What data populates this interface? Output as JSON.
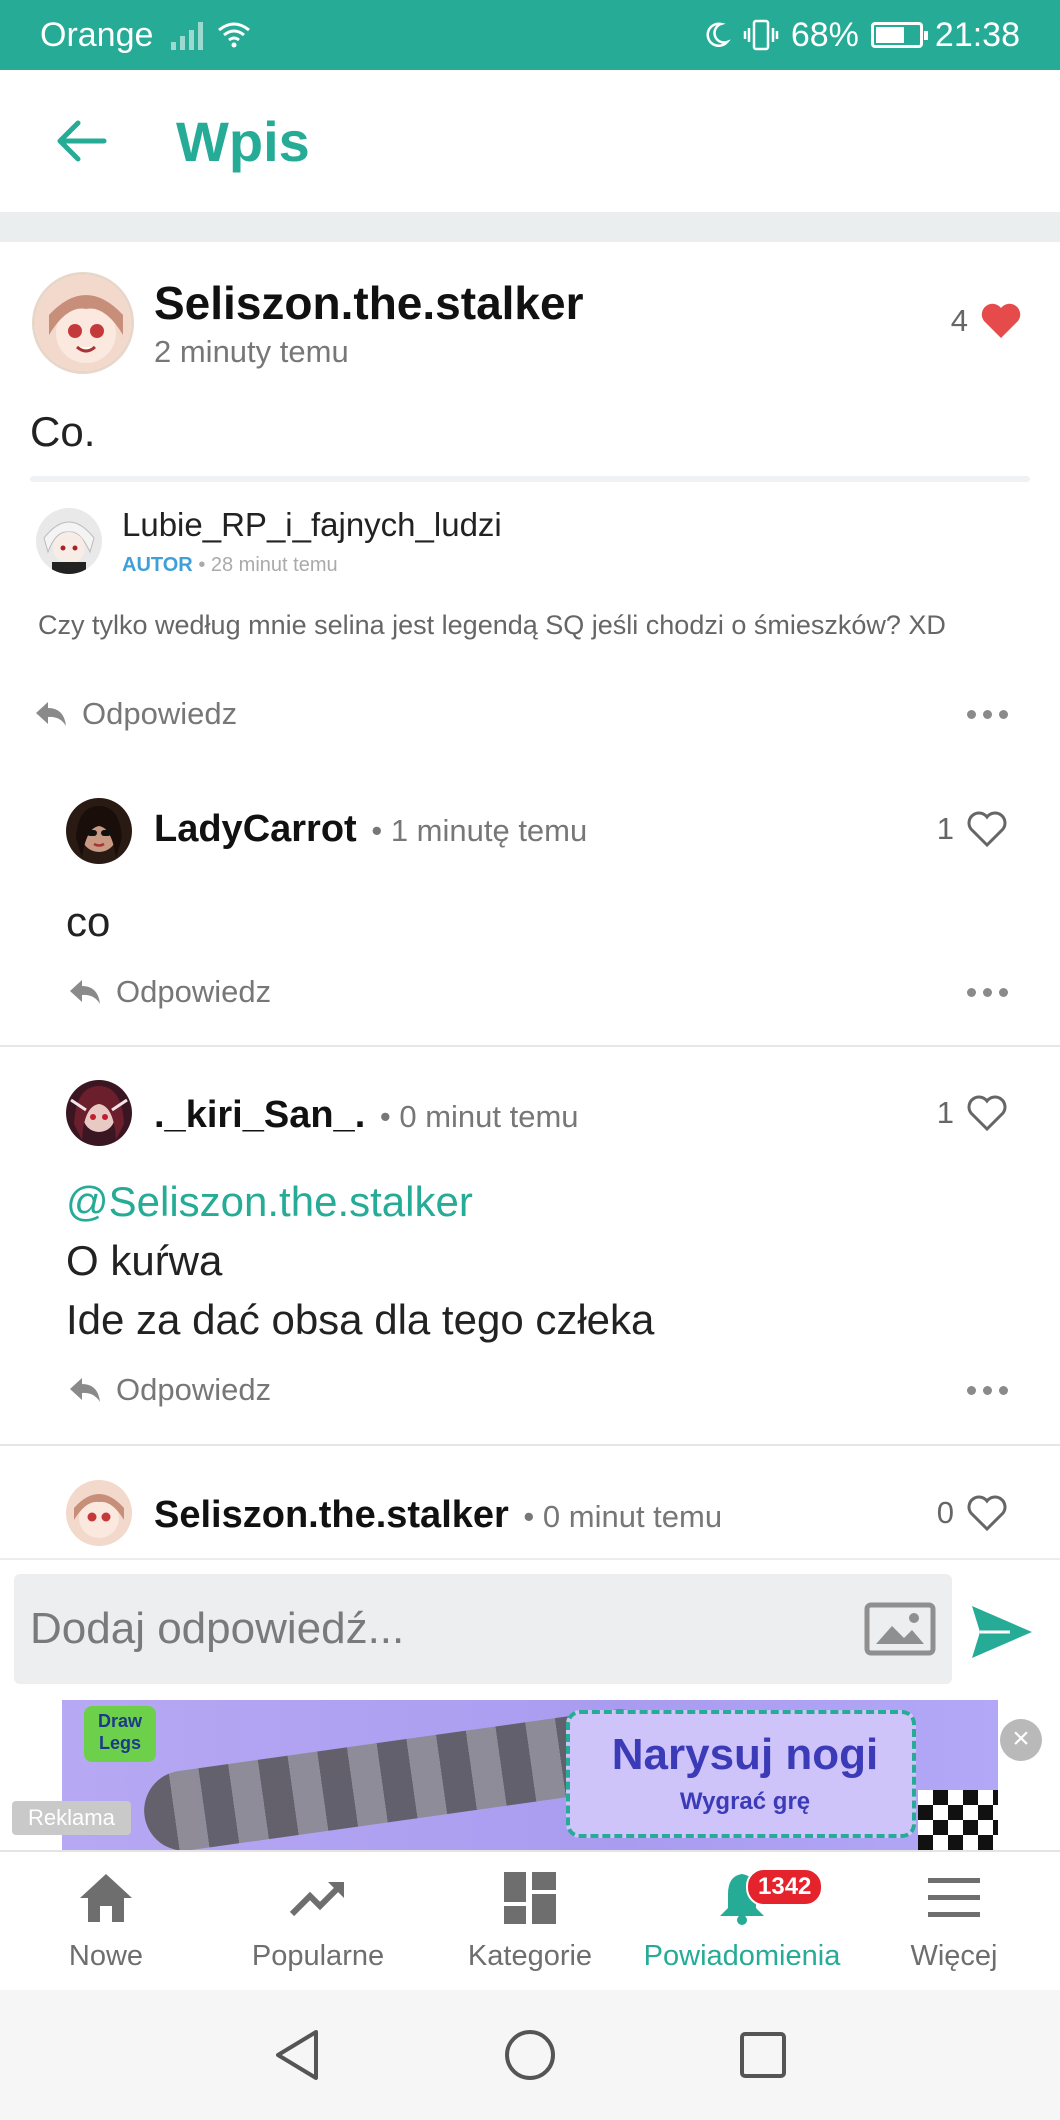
{
  "status_bar": {
    "carrier": "Orange",
    "battery": "68%",
    "time": "21:38",
    "battery_level": 0.68
  },
  "header": {
    "title": "Wpis"
  },
  "post": {
    "author": "Seliszon.the.stalker",
    "time": "2 minuty temu",
    "likes": "4",
    "text": "Co.",
    "quoted": {
      "author": "Lubie_RP_i_fajnych_ludzi",
      "role": "AUTOR",
      "time": "28 minut temu",
      "text": "Czy tylko według mnie selina jest legendą SQ jeśli chodzi o śmieszków? XD"
    },
    "reply_label": "Odpowiedz"
  },
  "comments": [
    {
      "author": "LadyCarrot",
      "time": "1 minutę temu",
      "likes": "1",
      "lines": [
        "co"
      ],
      "mention": "",
      "reply_label": "Odpowiedz"
    },
    {
      "author": "._kiri_San_.",
      "time": "0 minut temu",
      "likes": "1",
      "mention": "@Seliszon.the.stalker",
      "lines": [
        "O kuŕwa",
        "Ide za dać obsa dla tego człeka"
      ],
      "reply_label": "Odpowiedz"
    },
    {
      "author": "Seliszon.the.stalker",
      "time": "0 minut temu",
      "likes": "0"
    }
  ],
  "reply_input": {
    "placeholder": "Dodaj odpowiedź..."
  },
  "ad": {
    "label": "Reklama",
    "logo_text": "Draw Legs",
    "title": "Narysuj nogi",
    "subtitle": "Wygrać grę"
  },
  "bottom_nav": [
    {
      "label": "Nowe"
    },
    {
      "label": "Popularne"
    },
    {
      "label": "Kategorie"
    },
    {
      "label": "Powiadomienia",
      "badge": "1342"
    },
    {
      "label": "Więcej"
    }
  ],
  "colors": {
    "accent": "#26ab96",
    "heart": "#e54b4b",
    "badge": "#e5232c",
    "mention": "#26ab96",
    "autor": "#3fa0d8"
  }
}
